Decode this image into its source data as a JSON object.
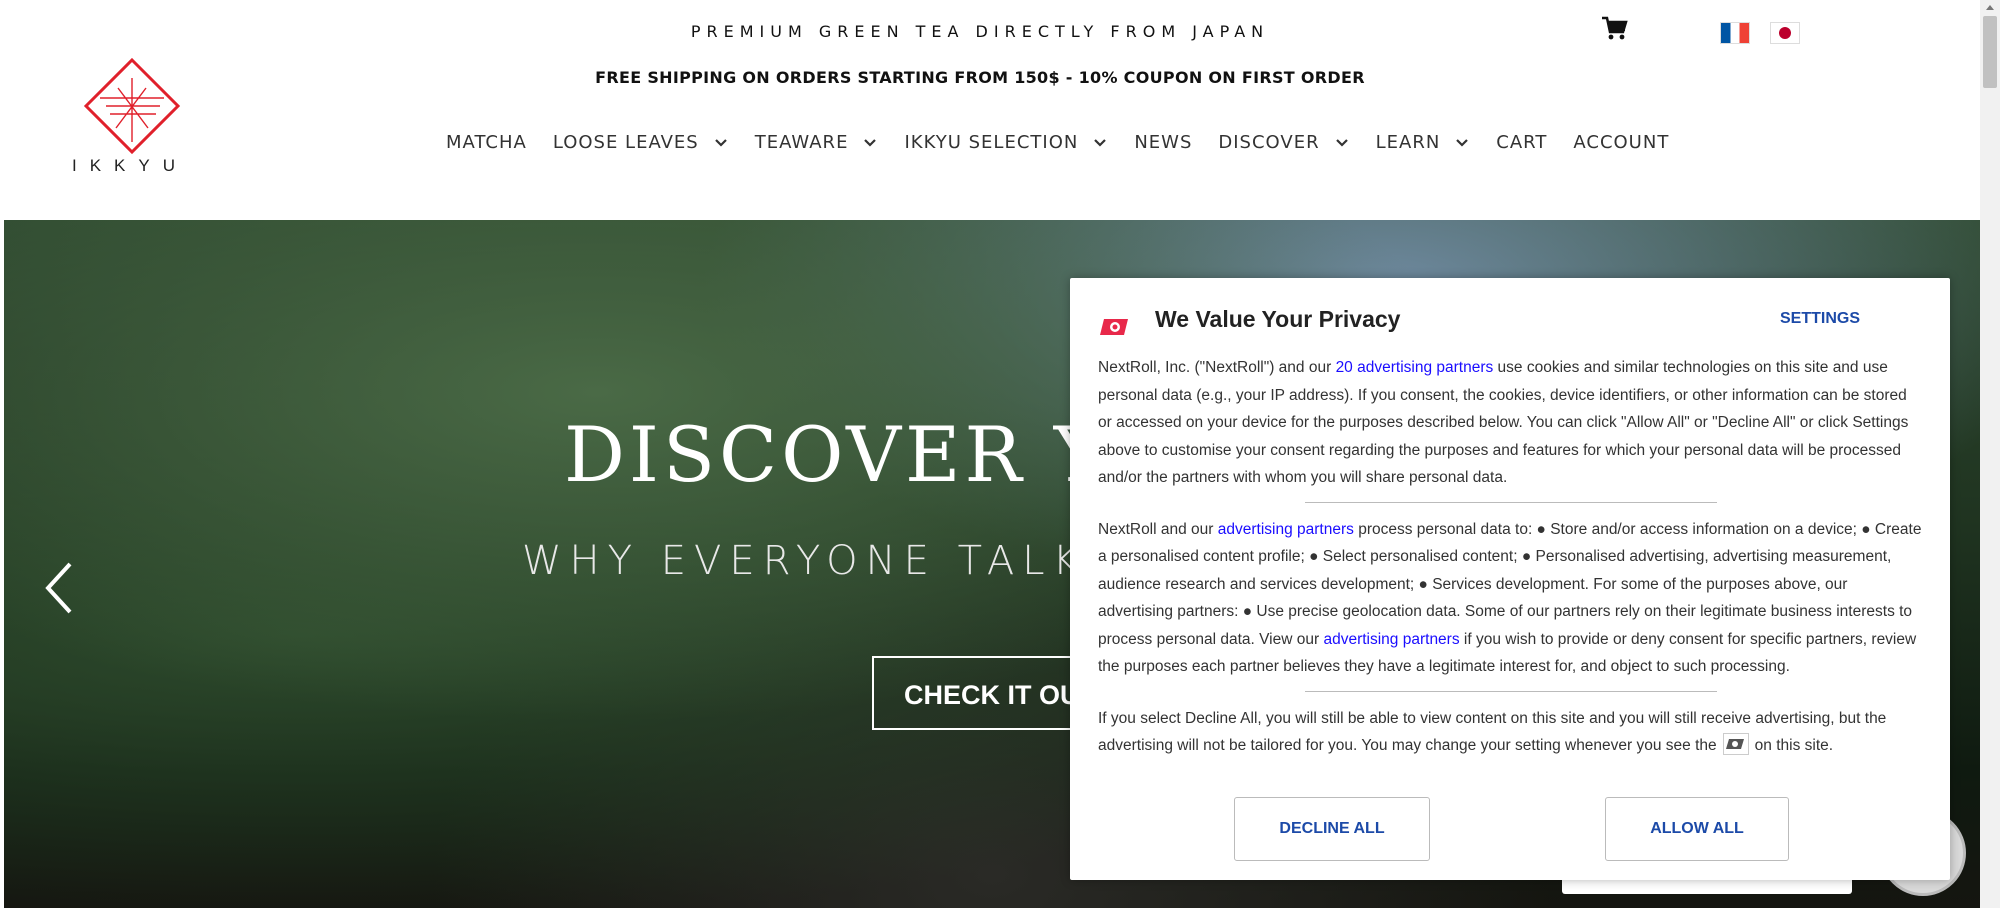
{
  "header": {
    "tagline": "PREMIUM GREEN TEA DIRECTLY FROM JAPAN",
    "shipping": "FREE SHIPPING ON ORDERS STARTING FROM 150$ - 10% COUPON ON FIRST ORDER",
    "logo_text": "IKKYU",
    "brand_color": "#e0202b"
  },
  "nav": {
    "items": [
      {
        "label": "MATCHA",
        "dropdown": false
      },
      {
        "label": "LOOSE LEAVES",
        "dropdown": true
      },
      {
        "label": "TEAWARE",
        "dropdown": true
      },
      {
        "label": "IKKYU SELECTION",
        "dropdown": true
      },
      {
        "label": "NEWS",
        "dropdown": false
      },
      {
        "label": "DISCOVER",
        "dropdown": true
      },
      {
        "label": "LEARN",
        "dropdown": true
      },
      {
        "label": "CART",
        "dropdown": false
      },
      {
        "label": "ACCOUNT",
        "dropdown": false
      }
    ]
  },
  "hero": {
    "title": "DISCOVER YA",
    "subtitle": "WHY EVERYONE TALK",
    "button": "CHECK IT OUT"
  },
  "consent": {
    "title": "We Value Your Privacy",
    "settings": "SETTINGS",
    "p1_a": "NextRoll, Inc. (\"NextRoll\") and our ",
    "p1_link": "20 advertising partners",
    "p1_b": " use cookies and similar technologies on this site and use personal data (e.g., your IP address). If you consent, the cookies, device identifiers, or other information can be stored or accessed on your device for the purposes described below. You can click \"Allow All\" or \"Decline All\" or click Settings above to customise your consent regarding the purposes and features for which your personal data will be processed and/or the partners with whom you will share personal data.",
    "p2_a": "NextRoll and our ",
    "p2_link1": "advertising partners",
    "p2_b": " process personal data to: ● Store and/or access information on a device; ● Create a personalised content profile; ● Select personalised content; ● Personalised advertising, advertising measurement, audience research and services development; ● Services development. For some of the purposes above, our advertising partners: ● Use precise geolocation data. Some of our partners rely on their legitimate business interests to process personal data. View our ",
    "p2_link2": "advertising partners",
    "p2_c": " if you wish to provide or deny consent for specific partners, review the purposes each partner believes they have a legitimate interest for, and object to such processing.",
    "p3_a": "If you select Decline All, you will still be able to view content on this site and you will still receive advertising, but the advertising will not be tailored for you. You may change your setting whenever you see the",
    "p3_b": "on this site.",
    "decline": "DECLINE ALL",
    "allow": "ALLOW ALL",
    "accent_color": "#1c4aa8",
    "logo_color": "#e8284a"
  }
}
